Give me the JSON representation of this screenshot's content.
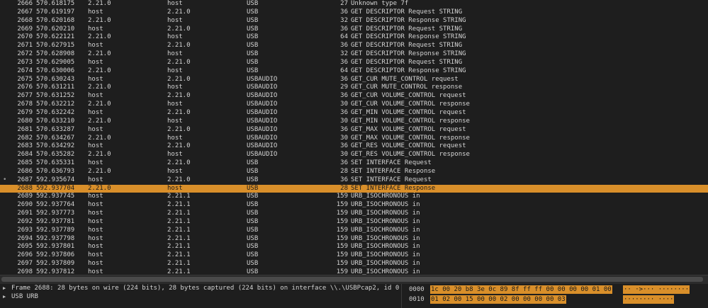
{
  "packets": [
    {
      "mark": "",
      "no": "2666",
      "time": "570.618175",
      "src": "2.21.0",
      "dst": "host",
      "proto": "USB",
      "len": "27",
      "info": "Unknown type 7f",
      "selected": false
    },
    {
      "mark": "",
      "no": "2667",
      "time": "570.619197",
      "src": "host",
      "dst": "2.21.0",
      "proto": "USB",
      "len": "36",
      "info": "GET DESCRIPTOR Request STRING",
      "selected": false
    },
    {
      "mark": "",
      "no": "2668",
      "time": "570.620168",
      "src": "2.21.0",
      "dst": "host",
      "proto": "USB",
      "len": "32",
      "info": "GET DESCRIPTOR Response STRING",
      "selected": false
    },
    {
      "mark": "",
      "no": "2669",
      "time": "570.620210",
      "src": "host",
      "dst": "2.21.0",
      "proto": "USB",
      "len": "36",
      "info": "GET DESCRIPTOR Request STRING",
      "selected": false
    },
    {
      "mark": "",
      "no": "2670",
      "time": "570.622121",
      "src": "2.21.0",
      "dst": "host",
      "proto": "USB",
      "len": "64",
      "info": "GET DESCRIPTOR Response STRING",
      "selected": false
    },
    {
      "mark": "",
      "no": "2671",
      "time": "570.627915",
      "src": "host",
      "dst": "2.21.0",
      "proto": "USB",
      "len": "36",
      "info": "GET DESCRIPTOR Request STRING",
      "selected": false
    },
    {
      "mark": "",
      "no": "2672",
      "time": "570.628908",
      "src": "2.21.0",
      "dst": "host",
      "proto": "USB",
      "len": "32",
      "info": "GET DESCRIPTOR Response STRING",
      "selected": false
    },
    {
      "mark": "",
      "no": "2673",
      "time": "570.629005",
      "src": "host",
      "dst": "2.21.0",
      "proto": "USB",
      "len": "36",
      "info": "GET DESCRIPTOR Request STRING",
      "selected": false
    },
    {
      "mark": "",
      "no": "2674",
      "time": "570.630006",
      "src": "2.21.0",
      "dst": "host",
      "proto": "USB",
      "len": "64",
      "info": "GET DESCRIPTOR Response STRING",
      "selected": false
    },
    {
      "mark": "",
      "no": "2675",
      "time": "570.630243",
      "src": "host",
      "dst": "2.21.0",
      "proto": "USBAUDIO",
      "len": "36",
      "info": "GET_CUR MUTE_CONTROL request",
      "selected": false
    },
    {
      "mark": "",
      "no": "2676",
      "time": "570.631211",
      "src": "2.21.0",
      "dst": "host",
      "proto": "USBAUDIO",
      "len": "29",
      "info": "GET_CUR MUTE_CONTROL response",
      "selected": false
    },
    {
      "mark": "",
      "no": "2677",
      "time": "570.631252",
      "src": "host",
      "dst": "2.21.0",
      "proto": "USBAUDIO",
      "len": "36",
      "info": "GET_CUR VOLUME_CONTROL request",
      "selected": false
    },
    {
      "mark": "",
      "no": "2678",
      "time": "570.632212",
      "src": "2.21.0",
      "dst": "host",
      "proto": "USBAUDIO",
      "len": "30",
      "info": "GET_CUR VOLUME_CONTROL response",
      "selected": false
    },
    {
      "mark": "",
      "no": "2679",
      "time": "570.632242",
      "src": "host",
      "dst": "2.21.0",
      "proto": "USBAUDIO",
      "len": "36",
      "info": "GET_MIN VOLUME_CONTROL request",
      "selected": false
    },
    {
      "mark": "",
      "no": "2680",
      "time": "570.633210",
      "src": "2.21.0",
      "dst": "host",
      "proto": "USBAUDIO",
      "len": "30",
      "info": "GET_MIN VOLUME_CONTROL response",
      "selected": false
    },
    {
      "mark": "",
      "no": "2681",
      "time": "570.633287",
      "src": "host",
      "dst": "2.21.0",
      "proto": "USBAUDIO",
      "len": "36",
      "info": "GET_MAX VOLUME_CONTROL request",
      "selected": false
    },
    {
      "mark": "",
      "no": "2682",
      "time": "570.634267",
      "src": "2.21.0",
      "dst": "host",
      "proto": "USBAUDIO",
      "len": "30",
      "info": "GET_MAX VOLUME_CONTROL response",
      "selected": false
    },
    {
      "mark": "",
      "no": "2683",
      "time": "570.634292",
      "src": "host",
      "dst": "2.21.0",
      "proto": "USBAUDIO",
      "len": "36",
      "info": "GET_RES VOLUME_CONTROL request",
      "selected": false
    },
    {
      "mark": "",
      "no": "2684",
      "time": "570.635282",
      "src": "2.21.0",
      "dst": "host",
      "proto": "USBAUDIO",
      "len": "30",
      "info": "GET_RES VOLUME_CONTROL response",
      "selected": false
    },
    {
      "mark": "",
      "no": "2685",
      "time": "570.635331",
      "src": "host",
      "dst": "2.21.0",
      "proto": "USB",
      "len": "36",
      "info": "SET INTERFACE Request",
      "selected": false
    },
    {
      "mark": "",
      "no": "2686",
      "time": "570.636793",
      "src": "2.21.0",
      "dst": "host",
      "proto": "USB",
      "len": "28",
      "info": "SET INTERFACE Response",
      "selected": false
    },
    {
      "mark": "•",
      "no": "2687",
      "time": "592.935674",
      "src": "host",
      "dst": "2.21.0",
      "proto": "USB",
      "len": "36",
      "info": "SET INTERFACE Request",
      "selected": false
    },
    {
      "mark": "",
      "no": "2688",
      "time": "592.937704",
      "src": "2.21.0",
      "dst": "host",
      "proto": "USB",
      "len": "28",
      "info": "SET INTERFACE Response",
      "selected": true
    },
    {
      "mark": "",
      "no": "2689",
      "time": "592.937745",
      "src": "host",
      "dst": "2.21.1",
      "proto": "USB",
      "len": "159",
      "info": "URB_ISOCHRONOUS in",
      "selected": false
    },
    {
      "mark": "",
      "no": "2690",
      "time": "592.937764",
      "src": "host",
      "dst": "2.21.1",
      "proto": "USB",
      "len": "159",
      "info": "URB_ISOCHRONOUS in",
      "selected": false
    },
    {
      "mark": "",
      "no": "2691",
      "time": "592.937773",
      "src": "host",
      "dst": "2.21.1",
      "proto": "USB",
      "len": "159",
      "info": "URB_ISOCHRONOUS in",
      "selected": false
    },
    {
      "mark": "",
      "no": "2692",
      "time": "592.937781",
      "src": "host",
      "dst": "2.21.1",
      "proto": "USB",
      "len": "159",
      "info": "URB_ISOCHRONOUS in",
      "selected": false
    },
    {
      "mark": "",
      "no": "2693",
      "time": "592.937789",
      "src": "host",
      "dst": "2.21.1",
      "proto": "USB",
      "len": "159",
      "info": "URB_ISOCHRONOUS in",
      "selected": false
    },
    {
      "mark": "",
      "no": "2694",
      "time": "592.937798",
      "src": "host",
      "dst": "2.21.1",
      "proto": "USB",
      "len": "159",
      "info": "URB_ISOCHRONOUS in",
      "selected": false
    },
    {
      "mark": "",
      "no": "2695",
      "time": "592.937801",
      "src": "host",
      "dst": "2.21.1",
      "proto": "USB",
      "len": "159",
      "info": "URB_ISOCHRONOUS in",
      "selected": false
    },
    {
      "mark": "",
      "no": "2696",
      "time": "592.937806",
      "src": "host",
      "dst": "2.21.1",
      "proto": "USB",
      "len": "159",
      "info": "URB_ISOCHRONOUS in",
      "selected": false
    },
    {
      "mark": "",
      "no": "2697",
      "time": "592.937809",
      "src": "host",
      "dst": "2.21.1",
      "proto": "USB",
      "len": "159",
      "info": "URB_ISOCHRONOUS in",
      "selected": false
    },
    {
      "mark": "",
      "no": "2698",
      "time": "592.937812",
      "src": "host",
      "dst": "2.21.1",
      "proto": "USB",
      "len": "159",
      "info": "URB_ISOCHRONOUS in",
      "selected": false
    }
  ],
  "details": [
    {
      "arrow": "▶",
      "text": "Frame 2688: 28 bytes on wire (224 bits), 28 bytes captured (224 bits) on interface \\\\.\\USBPcap2, id 0"
    },
    {
      "arrow": "▶",
      "text": "USB URB"
    }
  ],
  "bytes": [
    {
      "offset": "0000",
      "hex": "1c 00 20 b8 3e 0c 89 8f  ff ff 00 00 00 00 01 00",
      "ascii": "·· ·>··· ········"
    },
    {
      "offset": "0010",
      "hex": "01 02 00 15 00 00 02 00  00 00 00 03",
      "ascii": "········ ····"
    }
  ],
  "colors": {
    "background": "#1e1e1e",
    "text": "#d4d4d4",
    "selection": "#d98f2a"
  }
}
